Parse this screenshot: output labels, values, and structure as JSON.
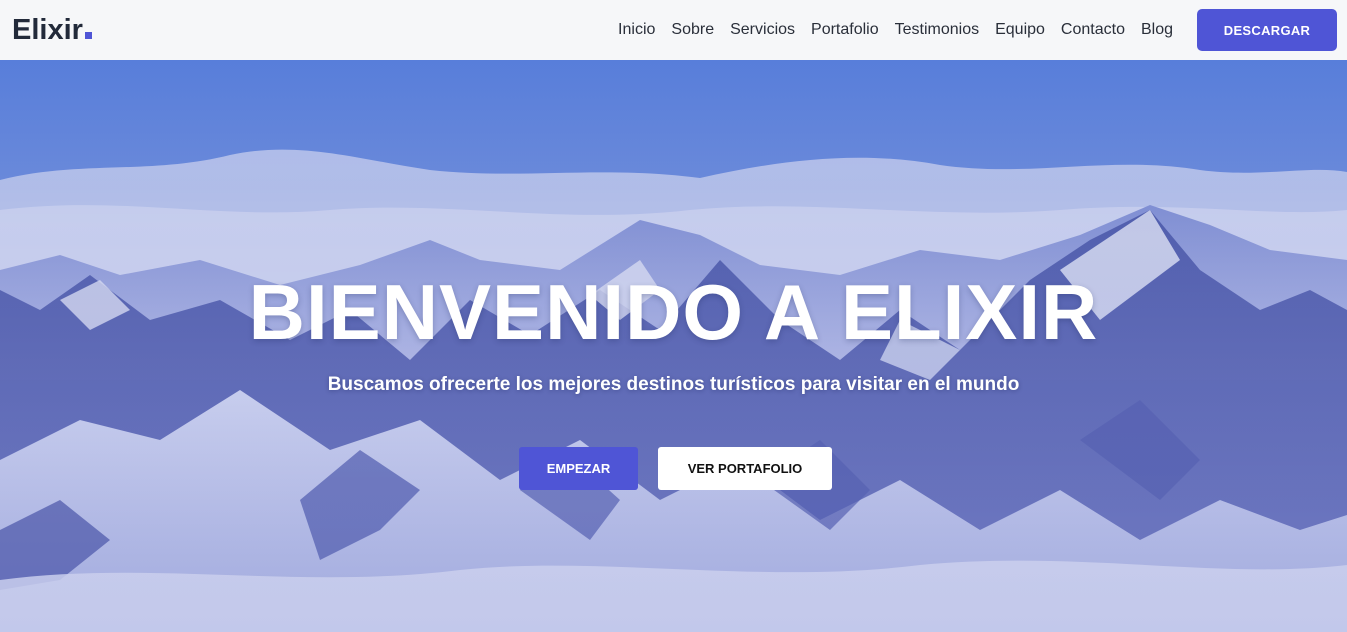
{
  "brand": {
    "name": "Elixir",
    "accent_color": "#4f55d6"
  },
  "nav": {
    "items": [
      {
        "label": "Inicio"
      },
      {
        "label": "Sobre"
      },
      {
        "label": "Servicios"
      },
      {
        "label": "Portafolio"
      },
      {
        "label": "Testimonios"
      },
      {
        "label": "Equipo"
      },
      {
        "label": "Contacto"
      },
      {
        "label": "Blog"
      }
    ],
    "download_label": "DESCARGAR"
  },
  "hero": {
    "title": "BIENVENIDO A ELIXIR",
    "subtitle": "Buscamos ofrecerte los mejores destinos turísticos para visitar en el mundo",
    "primary_button": "EMPEZAR",
    "secondary_button": "VER PORTAFOLIO",
    "background": "snowy-mountains-image"
  },
  "colors": {
    "primary": "#4f55d6",
    "navbar_bg": "#f6f7f9",
    "text_dark": "#2a2f3a"
  }
}
